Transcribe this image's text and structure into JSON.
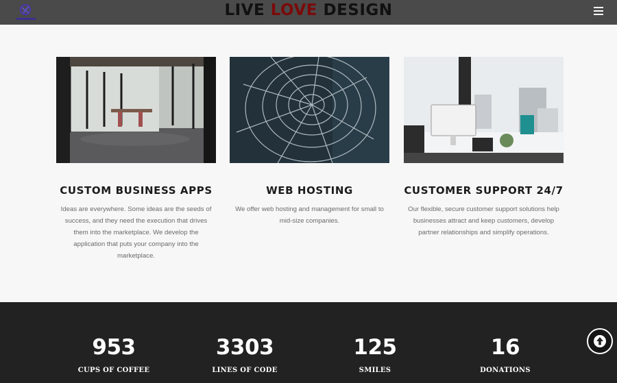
{
  "header": {
    "brand_part1": "LIVE ",
    "brand_part2": "LOVE",
    "brand_part3": " DESIGN",
    "accent_color": "#7a0a0a"
  },
  "services": [
    {
      "title": "CUSTOM BUSINESS APPS",
      "text": "Ideas are everywhere. Some ideas are the seeds of success, and they need the execution that drives them into the marketplace. We develop the application that puts your company into the marketplace."
    },
    {
      "title": "WEB HOSTING",
      "text": "We offer web hosting and management for small to mid-size companies."
    },
    {
      "title": "CUSTOMER SUPPORT 24/7",
      "text": "Our flexible, secure customer support solutions help businesses attract and keep customers, develop partner relationships and simplify operations."
    }
  ],
  "stats": [
    {
      "value": "953",
      "label": "CUPS OF COFFEE"
    },
    {
      "value": "3303",
      "label": "LINES OF CODE"
    },
    {
      "value": "125",
      "label": "SMILES"
    },
    {
      "value": "16",
      "label": "DONATIONS"
    }
  ],
  "icons": {
    "menu": "hamburger-menu-icon",
    "scroll_top": "arrow-up-icon",
    "logo": "logo-icon"
  }
}
